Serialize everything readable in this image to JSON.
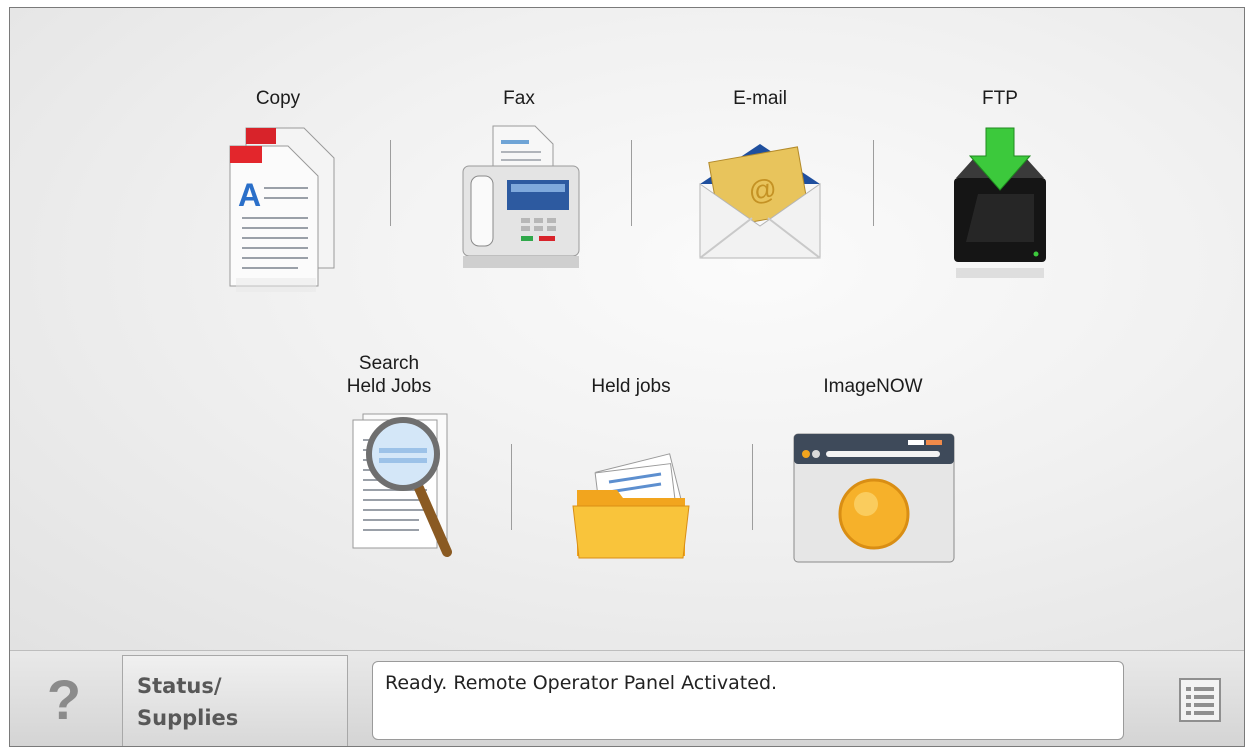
{
  "apps": {
    "copy": {
      "label": "Copy"
    },
    "fax": {
      "label": "Fax"
    },
    "email": {
      "label": "E-mail"
    },
    "ftp": {
      "label": "FTP"
    },
    "search_held_jobs": {
      "label": "Search\nHeld Jobs"
    },
    "held_jobs": {
      "label": "Held jobs"
    },
    "imagenow": {
      "label": "ImageNOW"
    }
  },
  "bottom_bar": {
    "help_label": "?",
    "status_line1": "Status/",
    "status_line2": "Supplies",
    "message": "Ready. Remote Operator Panel Activated."
  },
  "icons": {
    "copy": "copy-documents-icon",
    "fax": "fax-machine-icon",
    "email": "envelope-at-icon",
    "ftp": "ftp-drive-download-icon",
    "search_held_jobs": "magnifier-document-icon",
    "held_jobs": "folder-documents-icon",
    "imagenow": "imagenow-window-icon",
    "menu": "menu-list-icon"
  },
  "colors": {
    "background": "#f1f1f1",
    "bar": "#dcdcdc",
    "accent_red": "#d8232a",
    "accent_blue": "#2a6fc9",
    "ftp_green": "#3cc93c"
  }
}
